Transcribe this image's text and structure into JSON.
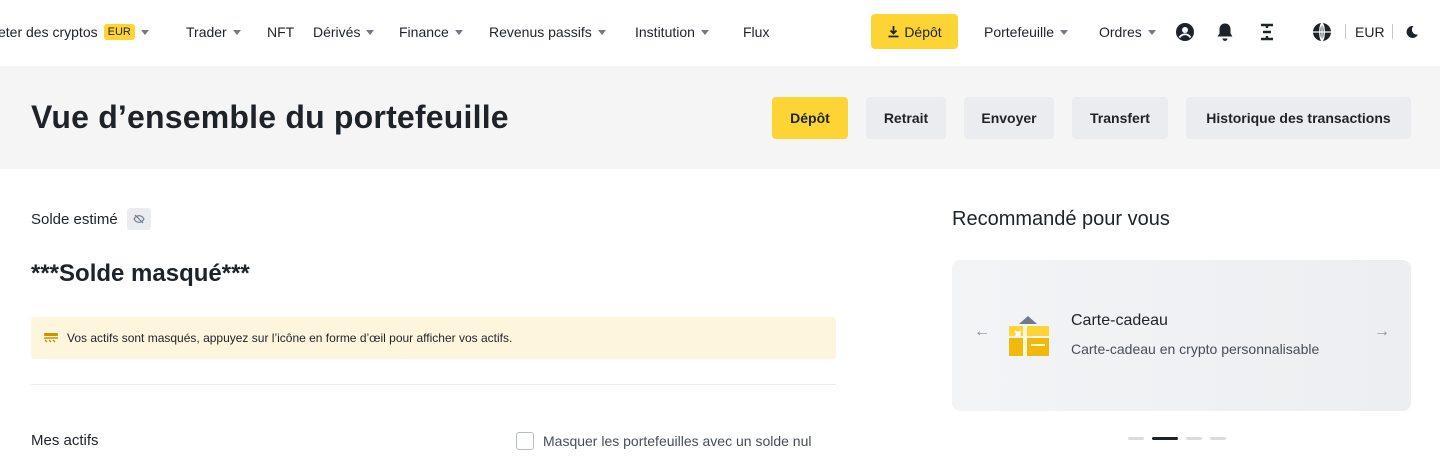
{
  "nav": {
    "buy_crypto": "eter des cryptos",
    "buy_badge": "EUR",
    "trader": "Trader",
    "nft": "NFT",
    "derives": "Dérivés",
    "finance": "Finance",
    "revenus": "Revenus passifs",
    "institution": "Institution",
    "flux": "Flux",
    "deposit": "Dépôt",
    "portefeuille": "Portefeuille",
    "ordres": "Ordres",
    "currency": "EUR",
    "icons": [
      "user-icon",
      "bell-icon",
      "download-app-icon",
      "globe-icon",
      "moon-icon"
    ]
  },
  "header": {
    "title": "Vue d’ensemble du portefeuille",
    "buttons": {
      "depot": "Dépôt",
      "retrait": "Retrait",
      "envoyer": "Envoyer",
      "transfert": "Transfert",
      "historique": "Historique des transactions"
    }
  },
  "balance": {
    "label": "Solde estimé",
    "hidden_value": "***Solde masqué***",
    "notice": "Vos actifs sont masqués, appuyez sur l’icône en forme d’œil pour afficher vos actifs."
  },
  "assets": {
    "title": "Mes actifs",
    "hide_zero_label": "Masquer les portefeuilles avec un solde nul"
  },
  "recommended": {
    "title": "Recommandé pour vous",
    "card_title": "Carte-cadeau",
    "card_subtitle": "Carte-cadeau en crypto personnalisable",
    "slides_total": 4,
    "slide_active": 2
  },
  "colors": {
    "brand_yellow": "#fcd535",
    "text": "#1e2329",
    "muted": "#707a8a",
    "header_bg": "#f5f5f5",
    "notice_bg": "#fdf6dd"
  }
}
